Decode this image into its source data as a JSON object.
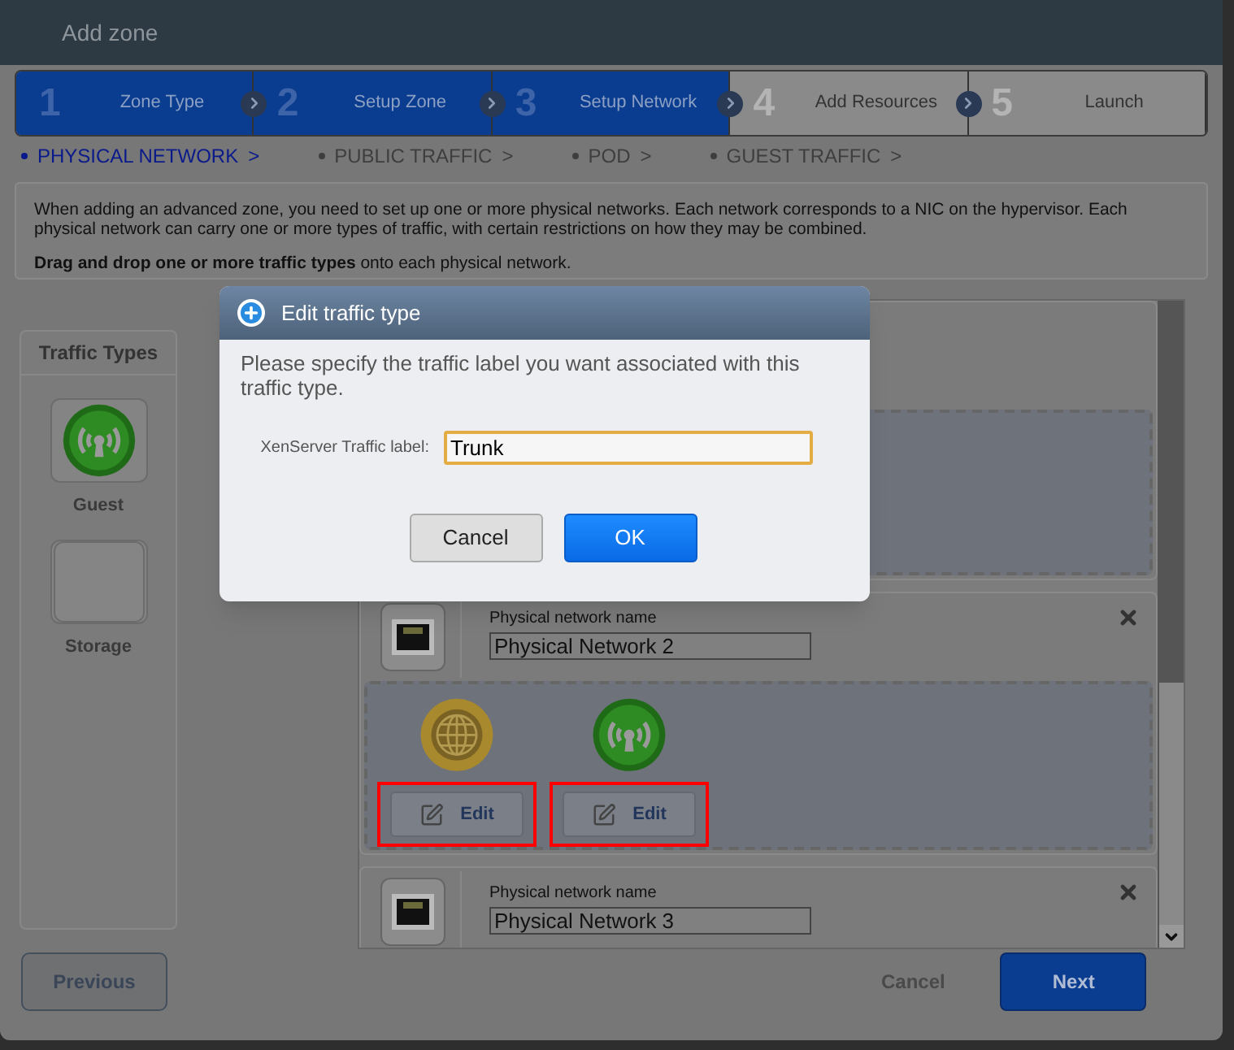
{
  "window": {
    "title": "Add zone"
  },
  "steps": [
    {
      "number": "1",
      "label": "Zone Type",
      "active": true
    },
    {
      "number": "2",
      "label": "Setup Zone",
      "active": true
    },
    {
      "number": "3",
      "label": "Setup Network",
      "active": true
    },
    {
      "number": "4",
      "label": "Add Resources",
      "active": false
    },
    {
      "number": "5",
      "label": "Launch",
      "active": false
    }
  ],
  "substeps": [
    {
      "label": "PHYSICAL NETWORK",
      "arrow": ">",
      "selected": true
    },
    {
      "label": "PUBLIC TRAFFIC",
      "arrow": ">",
      "selected": false
    },
    {
      "label": "POD",
      "arrow": ">",
      "selected": false
    },
    {
      "label": "GUEST TRAFFIC",
      "arrow": ">",
      "selected": false
    }
  ],
  "intro": {
    "text": "When adding an advanced zone, you need to set up one or more physical networks. Each network corresponds to a NIC on the hypervisor. Each physical network can carry one or more types of traffic, with certain restrictions on how they may be combined.",
    "instruction": "**Drag and drop one or more traffic types** onto each physical network."
  },
  "traffic_types": {
    "title": "Traffic Types",
    "items": [
      {
        "label": "Guest",
        "kind": "guest"
      },
      {
        "label": "Storage",
        "kind": "storage"
      }
    ]
  },
  "networks": [
    {
      "name_label": "Physical network name",
      "name": "Physical Network 2",
      "traffic": [
        {
          "kind": "public",
          "button": "Edit",
          "highlighted": true
        },
        {
          "kind": "guest",
          "button": "Edit",
          "highlighted": true
        }
      ]
    },
    {
      "name_label": "Physical network name",
      "name": "Physical Network 3"
    }
  ],
  "footer": {
    "previous": "Previous",
    "cancel": "Cancel",
    "next": "Next"
  },
  "dialog": {
    "title": "Edit traffic type",
    "message": "Please specify the traffic label you want associated with this traffic type.",
    "field_label": "XenServer Traffic label:",
    "value": "Trunk",
    "buttons": [
      {
        "label": "Cancel",
        "kind": "secondary"
      },
      {
        "label": "OK",
        "kind": "primary"
      }
    ]
  }
}
